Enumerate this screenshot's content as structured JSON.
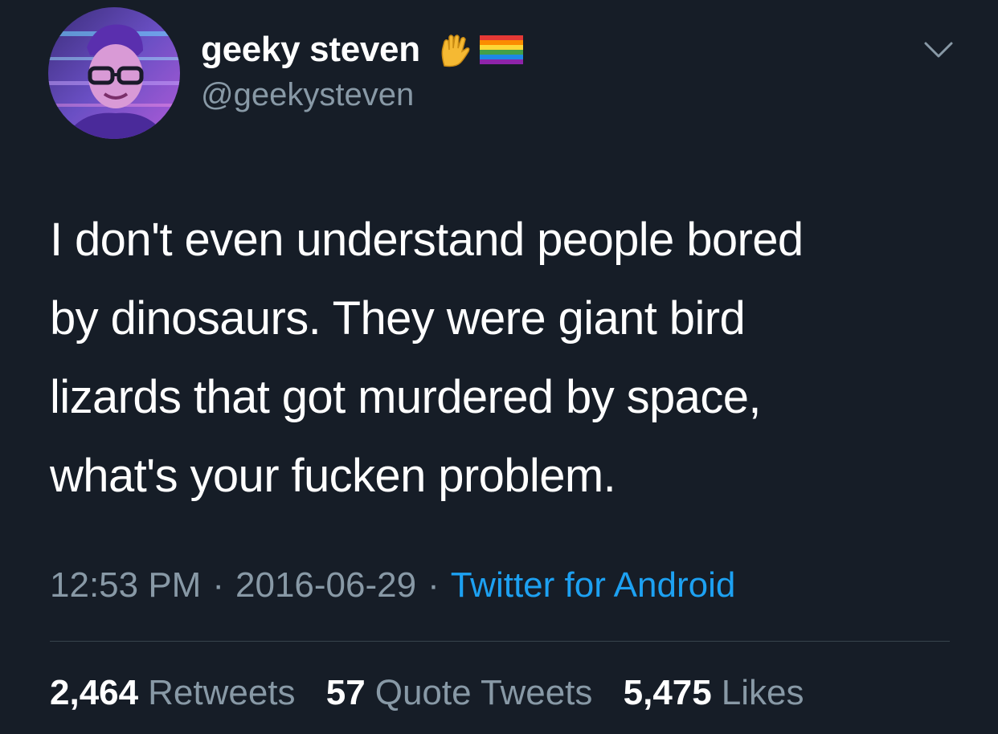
{
  "tweet": {
    "author": {
      "display_name": "geeky steven",
      "handle": "@geekysteven",
      "emoji": [
        "vulcan-salute-emoji",
        "rainbow-flag-emoji"
      ]
    },
    "text_lines": [
      "I don't even understand people bored",
      "by dinosaurs. They were giant bird",
      "lizards that got murdered by space,",
      "what's your fucken problem."
    ],
    "time": "12:53 PM",
    "date": "2016-06-29",
    "separator": "·",
    "source": "Twitter for Android",
    "stats": {
      "retweets_count": "2,464",
      "retweets_label": "Retweets",
      "quotes_count": "57",
      "quotes_label": "Quote Tweets",
      "likes_count": "5,475",
      "likes_label": "Likes"
    }
  },
  "colors": {
    "background": "#161d27",
    "text_primary": "#ffffff",
    "text_secondary": "#8899a6",
    "link": "#1da1f2",
    "divider": "#38444d"
  }
}
